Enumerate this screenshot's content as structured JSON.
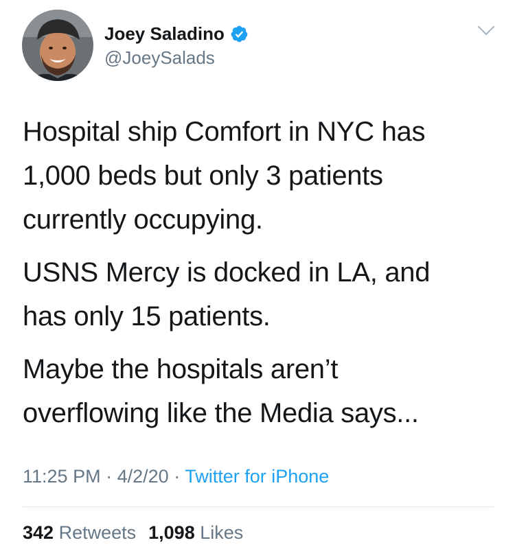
{
  "tweet": {
    "author": {
      "display_name": "Joey Saladino",
      "handle": "@JoeySalads",
      "verified": true
    },
    "paragraphs": [
      "Hospital ship Comfort in NYC has\n1,000 beds but only 3 patients\ncurrently occupying.",
      "USNS Mercy is docked in LA, and\nhas only 15 patients.",
      "Maybe the hospitals aren’t\noverflowing like the Media says..."
    ],
    "time": "11:25 PM",
    "date": "4/2/20",
    "separator": "·",
    "source": "Twitter for iPhone",
    "stats": {
      "retweets_count": "342",
      "retweets_label": "Retweets",
      "likes_count": "1,098",
      "likes_label": "Likes"
    }
  },
  "icons": {
    "verified": "verified-badge-icon",
    "chevron": "chevron-down-icon"
  },
  "colors": {
    "text": "#14171a",
    "secondary": "#657786",
    "accent": "#1da1f2",
    "divider": "#e1e8ed"
  }
}
